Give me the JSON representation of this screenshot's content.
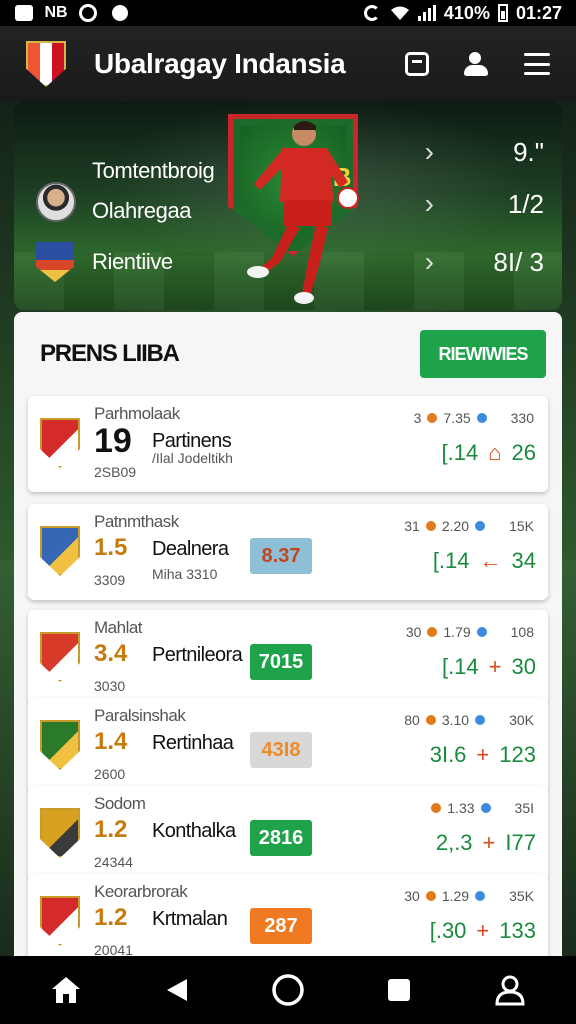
{
  "status_bar": {
    "left_icons": [
      "app-icon",
      "nfc-icon",
      "whatsapp-icon",
      "shield-icon"
    ],
    "nfc_text": "NB",
    "battery_text": "410%",
    "time": "01:27"
  },
  "app_bar": {
    "title": "Ubalragay Indansia",
    "actions": [
      "calendar-icon",
      "profile-icon",
      "menu-icon"
    ]
  },
  "hero": {
    "crest_text": "BB",
    "rows": [
      {
        "label": "Tomtentbroig",
        "value": "9.\"",
        "icon": "chevron-right-icon"
      },
      {
        "label": "Olahregaa",
        "value": "1/2",
        "icon": "chevron-right-icon"
      },
      {
        "label": "Rientiive",
        "value": "8I/ 3",
        "icon": "chevron-right-icon"
      }
    ]
  },
  "panel": {
    "title": "PRENS LIIBA",
    "cta_label": "RIEWIWIES"
  },
  "matches": [
    {
      "top": "Parhmolaak",
      "score": "19",
      "team": "Partinens",
      "sub": "2SB09",
      "sub2": "/Ilal\nJodeltikh",
      "chip": "",
      "chip_color": "",
      "meta": [
        "3",
        "7.35",
        "330"
      ],
      "odds": [
        "[.14",
        "⌂",
        "26"
      ],
      "crest_color": "#d42a2a",
      "alt": "#ffffff"
    },
    {
      "top": "Patnmthask",
      "score": "1.5",
      "team": "Dealnera",
      "sub": "3309",
      "sub2": "Miha 3310",
      "chip": "8.37",
      "chip_color": "#8fbfd6",
      "meta": [
        "31",
        "2.20",
        "15K"
      ],
      "odds": [
        "[.14",
        "←",
        "34"
      ],
      "crest_color": "#3667b5",
      "alt": "#f0c040"
    },
    {
      "top": "Mahlat",
      "score": "3.4",
      "team": "Pertnileora",
      "sub": "3030",
      "sub2": "",
      "chip": "7015",
      "chip_color": "#1fa34a",
      "meta": [
        "30",
        "1.79",
        "108"
      ],
      "odds": [
        "[.14",
        "+",
        "30"
      ],
      "crest_color": "#d83a2a",
      "alt": "#ffffff"
    },
    {
      "top": "Paralsinshak",
      "score": "1.4",
      "team": "Rertinhaa",
      "sub": "2600",
      "sub2": "",
      "chip": "43I8",
      "chip_color": "#d8d8d8",
      "meta": [
        "80",
        "3.10",
        "30K"
      ],
      "odds": [
        "3I.6",
        "+",
        "123"
      ],
      "crest_color": "#2b7a2a",
      "alt": "#f0c040"
    },
    {
      "top": "Sodom",
      "score": "1.2",
      "team": "Konthalka",
      "sub": "24344",
      "sub2": "",
      "chip": "2816",
      "chip_color": "#1fa34a",
      "meta": [
        "",
        "1.33",
        "35I"
      ],
      "odds": [
        "2,.3",
        "+",
        "I77"
      ],
      "crest_color": "#d8a020",
      "alt": "#3a3a3a"
    },
    {
      "top": "Keorarbrorak",
      "score": "1.2",
      "team": "Krtmalan",
      "sub": "20041",
      "sub2": "",
      "chip": "287",
      "chip_color": "#ef7a22",
      "meta": [
        "30",
        "1.29",
        "35K"
      ],
      "odds": [
        "[.30",
        "+",
        "133"
      ],
      "crest_color": "#d42a2a",
      "alt": "#ffffff"
    }
  ],
  "bottom_nav": [
    "home-icon",
    "back-icon",
    "home-button-icon",
    "recents-icon",
    "account-icon"
  ]
}
